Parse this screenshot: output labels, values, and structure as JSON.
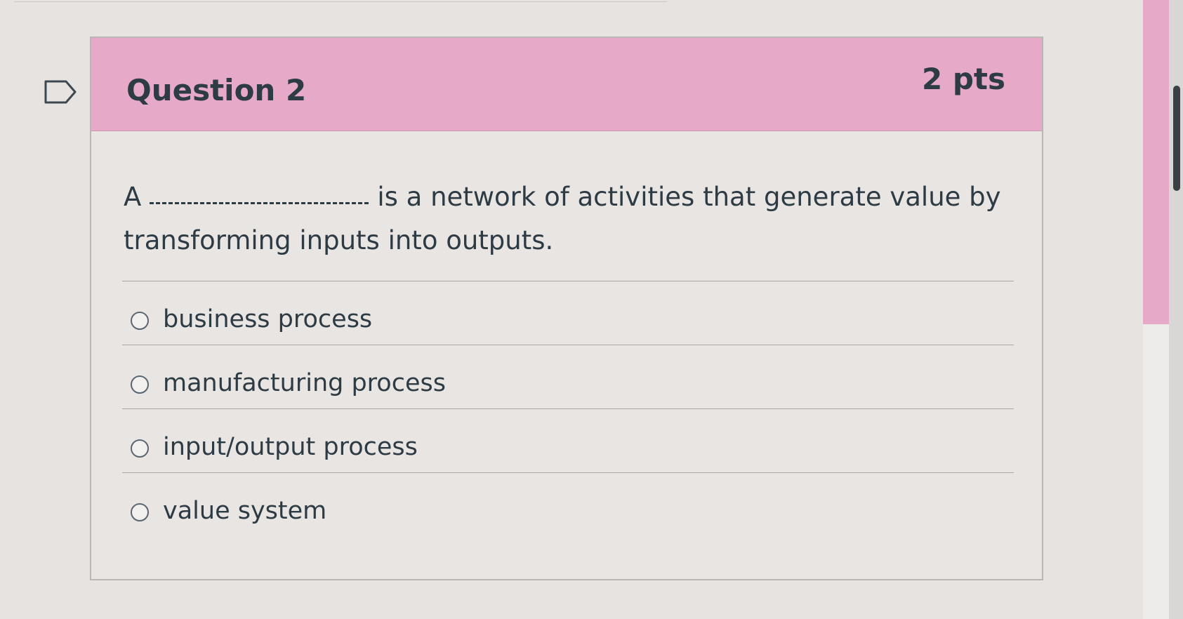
{
  "question": {
    "title": "Question 2",
    "points": "2 pts",
    "text_before_blank": "A",
    "text_after_blank": "is a network of activities that generate value by transforming inputs into outputs."
  },
  "answers": [
    {
      "label": "business process",
      "selected": false
    },
    {
      "label": "manufacturing process",
      "selected": false
    },
    {
      "label": "input/output process",
      "selected": false
    },
    {
      "label": "value system",
      "selected": false
    }
  ],
  "icons": {
    "flag": "flag-question-icon"
  },
  "colors": {
    "header_background": "#e7a9c8",
    "text": "#2d3b45",
    "page_background": "#e6e3e0"
  }
}
